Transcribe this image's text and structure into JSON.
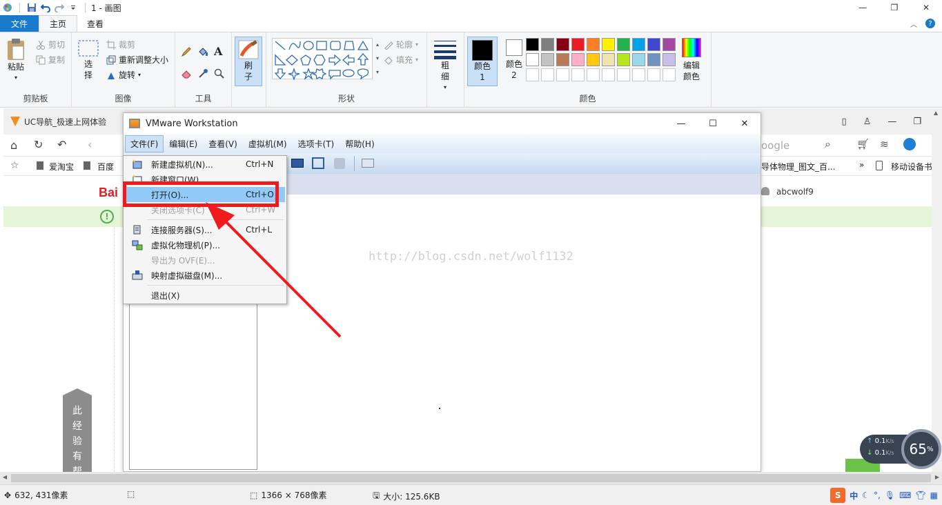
{
  "paint": {
    "title": "1 - 画图",
    "tabs": {
      "file": "文件",
      "home": "主页",
      "view": "查看"
    },
    "clipboard": {
      "paste": "粘贴",
      "cut": "剪切",
      "copy": "复制",
      "label": "剪贴板"
    },
    "image": {
      "select": "选择",
      "crop": "裁剪",
      "resize": "重新调整大小",
      "rotate": "旋转",
      "label": "图像"
    },
    "tools": {
      "label": "工具"
    },
    "brush": {
      "label": "刷子"
    },
    "shapes": {
      "outline": "轮廓",
      "fill": "填充",
      "label": "形状"
    },
    "size": {
      "label": "粗细"
    },
    "colors": {
      "color1": "颜色 1",
      "color2": "颜色 2",
      "edit": "编辑颜色",
      "label": "颜色",
      "palette_row1": [
        "#000000",
        "#7f7f7f",
        "#880015",
        "#ed1c24",
        "#ff7f27",
        "#fff200",
        "#22b14c",
        "#00a2e8",
        "#3f48cc",
        "#a349a4"
      ],
      "palette_row2": [
        "#ffffff",
        "#c3c3c3",
        "#b97a57",
        "#ffaec9",
        "#ffc90e",
        "#efe4b0",
        "#b5e61d",
        "#99d9ea",
        "#7092be",
        "#c8bfe7"
      ]
    },
    "status": {
      "cursor": "632, 431像素",
      "dimensions": "1366 × 768像素",
      "filesize": "大小: 125.6KB"
    }
  },
  "browser": {
    "tab_title": "UC导航_极速上网体验",
    "search_hint": "oogle",
    "bookmarks": [
      "爱淘宝",
      "百度"
    ],
    "bookmarks_right": "导体物理_图文_百...",
    "bookmarks_overflow": "»",
    "mobile_bookmarks": "移动设备书",
    "user": "abcwolf9",
    "logo_partial": "Bai",
    "side_tab": [
      "此",
      "经",
      "验",
      "有",
      "帮"
    ]
  },
  "vmware": {
    "title": "VMware Workstation",
    "menus": [
      "文件(F)",
      "编辑(E)",
      "查看(V)",
      "虚拟机(M)",
      "选项卡(T)",
      "帮助(H)"
    ],
    "watermark": "http://blog.csdn.net/wolf1132",
    "file_menu": [
      {
        "label": "新建虚拟机(N)...",
        "shortcut": "Ctrl+N"
      },
      {
        "label": "新建窗口(W)",
        "shortcut": ""
      },
      {
        "label": "打开(O)...",
        "shortcut": "Ctrl+O"
      },
      {
        "label": "关闭选项卡(C)",
        "shortcut": "Ctrl+W"
      },
      {
        "label": "连接服务器(S)...",
        "shortcut": "Ctrl+L"
      },
      {
        "label": "虚拟化物理机(P)...",
        "shortcut": ""
      },
      {
        "label": "导出为 OVF(E)...",
        "shortcut": ""
      },
      {
        "label": "映射虚拟磁盘(M)...",
        "shortcut": ""
      },
      {
        "label": "退出(X)",
        "shortcut": ""
      }
    ]
  },
  "netmon": {
    "up": "0.1",
    "down": "0.1",
    "unit": "K/s",
    "percent": "65",
    "percent_sign": "%"
  },
  "ime": {
    "logo": "S",
    "lang": "中"
  }
}
